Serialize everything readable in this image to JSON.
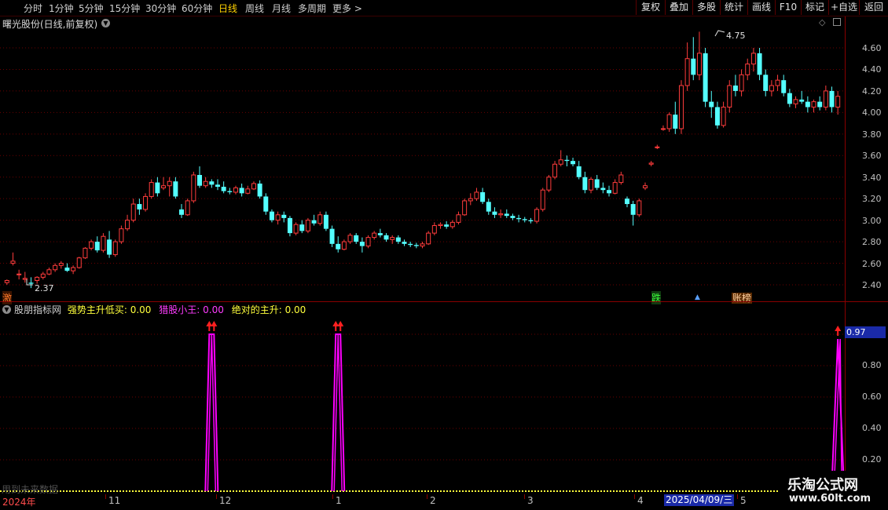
{
  "toolbar": {
    "periods": [
      "分时",
      "1分钟",
      "5分钟",
      "15分钟",
      "30分钟",
      "60分钟",
      "日线",
      "周线",
      "月线",
      "多周期",
      "更多"
    ],
    "active_period": "日线",
    "more_arrow": ">",
    "right_buttons": [
      "复权",
      "叠加",
      "多股",
      "统计",
      "画线",
      "F10",
      "标记",
      "+自选",
      "返回"
    ]
  },
  "stock_title": "曙光股份(日线,前复权)",
  "price_axis": [
    "4.60",
    "4.40",
    "4.20",
    "4.00",
    "3.80",
    "3.60",
    "3.40",
    "3.20",
    "3.00",
    "2.80",
    "2.60",
    "2.40"
  ],
  "price_annotations": {
    "high": "4.75",
    "low": "2.37"
  },
  "chart_tags": {
    "left": "激",
    "die": "跌",
    "zhang": "账榜"
  },
  "indicator": {
    "name": "股朋指标网",
    "line1_label": "强势主升低买:",
    "line1_value": "0.00",
    "line2_label": "猎股小王:",
    "line2_value": "0.00",
    "line3_label": "绝对的主升:",
    "line3_value": "0.00",
    "current_value": "0.97",
    "axis": [
      "0.80",
      "0.60",
      "0.40",
      "0.20"
    ]
  },
  "footer_note": "用到未来数据",
  "date_axis": {
    "labels": [
      "2024年",
      "11",
      "12",
      "1",
      "2",
      "3",
      "4",
      "5"
    ],
    "cursor_date": "2025/04/09/三"
  },
  "watermark": {
    "line1": "乐淘公式网",
    "line2": "www.60lt.com"
  },
  "colors": {
    "up": "#ff3c3c",
    "down": "#54ffff",
    "indicator": "#ff00ff",
    "active": "#ffd200"
  },
  "chart_data": {
    "type": "candlestick",
    "y_axis": {
      "min": 2.3,
      "max": 4.8,
      "ticks": [
        2.4,
        2.6,
        2.8,
        3.0,
        3.2,
        3.4,
        3.6,
        3.8,
        4.0,
        4.2,
        4.4,
        4.6
      ]
    },
    "candles": [
      [
        2.42,
        2.45,
        2.4,
        2.44
      ],
      [
        2.6,
        2.7,
        2.58,
        2.62
      ],
      [
        2.5,
        2.54,
        2.45,
        2.5
      ],
      [
        2.45,
        2.52,
        2.42,
        2.46
      ],
      [
        2.42,
        2.47,
        2.37,
        2.41
      ],
      [
        2.44,
        2.48,
        2.41,
        2.47
      ],
      [
        2.47,
        2.52,
        2.45,
        2.5
      ],
      [
        2.5,
        2.56,
        2.49,
        2.54
      ],
      [
        2.54,
        2.6,
        2.52,
        2.58
      ],
      [
        2.58,
        2.62,
        2.55,
        2.6
      ],
      [
        2.56,
        2.6,
        2.52,
        2.53
      ],
      [
        2.53,
        2.58,
        2.5,
        2.56
      ],
      [
        2.56,
        2.66,
        2.55,
        2.65
      ],
      [
        2.65,
        2.75,
        2.64,
        2.74
      ],
      [
        2.74,
        2.82,
        2.72,
        2.8
      ],
      [
        2.8,
        2.85,
        2.7,
        2.72
      ],
      [
        2.72,
        2.88,
        2.7,
        2.85
      ],
      [
        2.82,
        2.9,
        2.65,
        2.68
      ],
      [
        2.68,
        2.82,
        2.66,
        2.8
      ],
      [
        2.8,
        2.95,
        2.78,
        2.92
      ],
      [
        2.92,
        3.05,
        2.9,
        3.0
      ],
      [
        3.0,
        3.2,
        2.98,
        3.15
      ],
      [
        3.15,
        3.2,
        3.05,
        3.1
      ],
      [
        3.1,
        3.25,
        3.08,
        3.22
      ],
      [
        3.22,
        3.38,
        3.2,
        3.35
      ],
      [
        3.35,
        3.4,
        3.22,
        3.25
      ],
      [
        3.3,
        3.4,
        3.28,
        3.32
      ],
      [
        3.32,
        3.4,
        3.22,
        3.36
      ],
      [
        3.36,
        3.4,
        3.2,
        3.22
      ],
      [
        3.1,
        3.15,
        3.02,
        3.05
      ],
      [
        3.05,
        3.2,
        3.04,
        3.18
      ],
      [
        3.18,
        3.45,
        3.16,
        3.42
      ],
      [
        3.42,
        3.5,
        3.3,
        3.32
      ],
      [
        3.32,
        3.4,
        3.3,
        3.36
      ],
      [
        3.36,
        3.38,
        3.3,
        3.33
      ],
      [
        3.33,
        3.38,
        3.28,
        3.31
      ],
      [
        3.31,
        3.36,
        3.25,
        3.27
      ],
      [
        3.27,
        3.3,
        3.24,
        3.26
      ],
      [
        3.26,
        3.32,
        3.24,
        3.3
      ],
      [
        3.3,
        3.34,
        3.22,
        3.25
      ],
      [
        3.25,
        3.32,
        3.24,
        3.29
      ],
      [
        3.29,
        3.36,
        3.28,
        3.34
      ],
      [
        3.34,
        3.37,
        3.2,
        3.22
      ],
      [
        3.22,
        3.25,
        3.05,
        3.08
      ],
      [
        3.08,
        3.1,
        2.98,
        3.0
      ],
      [
        3.0,
        3.08,
        2.96,
        3.05
      ],
      [
        3.05,
        3.08,
        2.98,
        3.02
      ],
      [
        3.02,
        3.04,
        2.85,
        2.88
      ],
      [
        2.88,
        2.98,
        2.86,
        2.96
      ],
      [
        2.96,
        3.0,
        2.88,
        2.9
      ],
      [
        2.9,
        3.02,
        2.88,
        3.0
      ],
      [
        3.0,
        3.05,
        2.95,
        2.97
      ],
      [
        2.97,
        3.08,
        2.95,
        3.05
      ],
      [
        3.05,
        3.08,
        2.9,
        2.92
      ],
      [
        2.92,
        2.95,
        2.75,
        2.78
      ],
      [
        2.78,
        2.85,
        2.7,
        2.73
      ],
      [
        2.73,
        2.82,
        2.72,
        2.8
      ],
      [
        2.8,
        2.88,
        2.78,
        2.86
      ],
      [
        2.86,
        2.88,
        2.78,
        2.8
      ],
      [
        2.8,
        2.84,
        2.7,
        2.76
      ],
      [
        2.76,
        2.86,
        2.74,
        2.84
      ],
      [
        2.84,
        2.9,
        2.82,
        2.88
      ],
      [
        2.88,
        2.92,
        2.84,
        2.86
      ],
      [
        2.86,
        2.88,
        2.8,
        2.82
      ],
      [
        2.82,
        2.86,
        2.78,
        2.84
      ],
      [
        2.84,
        2.86,
        2.78,
        2.8
      ],
      [
        2.8,
        2.82,
        2.76,
        2.78
      ],
      [
        2.78,
        2.8,
        2.75,
        2.77
      ],
      [
        2.77,
        2.79,
        2.74,
        2.76
      ],
      [
        2.76,
        2.8,
        2.74,
        2.78
      ],
      [
        2.78,
        2.9,
        2.77,
        2.88
      ],
      [
        2.88,
        2.98,
        2.86,
        2.95
      ],
      [
        2.95,
        2.98,
        2.92,
        2.96
      ],
      [
        2.96,
        2.99,
        2.92,
        2.94
      ],
      [
        2.94,
        3.0,
        2.92,
        2.98
      ],
      [
        2.98,
        3.08,
        2.96,
        3.05
      ],
      [
        3.05,
        3.2,
        3.04,
        3.18
      ],
      [
        3.18,
        3.25,
        3.14,
        3.2
      ],
      [
        3.2,
        3.3,
        3.18,
        3.26
      ],
      [
        3.26,
        3.3,
        3.15,
        3.17
      ],
      [
        3.17,
        3.2,
        3.05,
        3.08
      ],
      [
        3.08,
        3.12,
        3.02,
        3.05
      ],
      [
        3.05,
        3.1,
        3.02,
        3.06
      ],
      [
        3.06,
        3.1,
        3.02,
        3.04
      ],
      [
        3.04,
        3.06,
        3.0,
        3.02
      ],
      [
        3.02,
        3.05,
        2.98,
        3.01
      ],
      [
        3.01,
        3.03,
        2.98,
        3.0
      ],
      [
        3.0,
        3.02,
        2.97,
        2.99
      ],
      [
        2.99,
        3.12,
        2.97,
        3.1
      ],
      [
        3.1,
        3.3,
        3.08,
        3.28
      ],
      [
        3.28,
        3.42,
        3.26,
        3.4
      ],
      [
        3.4,
        3.55,
        3.38,
        3.52
      ],
      [
        3.52,
        3.65,
        3.5,
        3.56
      ],
      [
        3.56,
        3.6,
        3.5,
        3.55
      ],
      [
        3.55,
        3.58,
        3.5,
        3.52
      ],
      [
        3.5,
        3.55,
        3.38,
        3.4
      ],
      [
        3.4,
        3.45,
        3.25,
        3.28
      ],
      [
        3.28,
        3.4,
        3.25,
        3.38
      ],
      [
        3.38,
        3.42,
        3.28,
        3.3
      ],
      [
        3.3,
        3.35,
        3.25,
        3.28
      ],
      [
        3.28,
        3.32,
        3.22,
        3.25
      ],
      [
        3.25,
        3.38,
        3.24,
        3.35
      ],
      [
        3.35,
        3.45,
        3.33,
        3.42
      ],
      [
        3.2,
        3.22,
        3.12,
        3.15
      ],
      [
        3.15,
        3.18,
        2.95,
        3.05
      ],
      [
        3.05,
        3.2,
        3.03,
        3.18
      ],
      [
        3.3,
        3.35,
        3.28,
        3.32
      ],
      [
        3.52,
        3.55,
        3.5,
        3.53
      ],
      [
        3.68,
        3.7,
        3.66,
        3.68
      ],
      [
        3.85,
        3.88,
        3.83,
        3.85
      ],
      [
        3.85,
        4.0,
        3.82,
        3.98
      ],
      [
        3.98,
        4.1,
        3.8,
        3.85
      ],
      [
        3.85,
        4.3,
        3.8,
        4.25
      ],
      [
        4.25,
        4.65,
        4.2,
        4.5
      ],
      [
        4.5,
        4.7,
        4.3,
        4.35
      ],
      [
        4.35,
        4.75,
        4.3,
        4.55
      ],
      [
        4.55,
        4.6,
        4.05,
        4.1
      ],
      [
        4.1,
        4.2,
        3.95,
        4.05
      ],
      [
        4.05,
        4.1,
        3.85,
        3.88
      ],
      [
        3.88,
        4.1,
        3.86,
        4.05
      ],
      [
        4.05,
        4.3,
        4.0,
        4.25
      ],
      [
        4.25,
        4.35,
        4.15,
        4.2
      ],
      [
        4.2,
        4.4,
        4.15,
        4.35
      ],
      [
        4.35,
        4.5,
        4.3,
        4.45
      ],
      [
        4.45,
        4.6,
        4.38,
        4.55
      ],
      [
        4.55,
        4.6,
        4.3,
        4.35
      ],
      [
        4.35,
        4.4,
        4.15,
        4.2
      ],
      [
        4.2,
        4.3,
        4.15,
        4.25
      ],
      [
        4.25,
        4.35,
        4.2,
        4.3
      ],
      [
        4.3,
        4.35,
        4.15,
        4.18
      ],
      [
        4.18,
        4.22,
        4.05,
        4.08
      ],
      [
        4.08,
        4.15,
        4.04,
        4.12
      ],
      [
        4.12,
        4.2,
        4.08,
        4.1
      ],
      [
        4.1,
        4.15,
        4.0,
        4.05
      ],
      [
        4.05,
        4.12,
        4.0,
        4.1
      ],
      [
        4.1,
        4.15,
        4.02,
        4.05
      ],
      [
        4.05,
        4.25,
        4.02,
        4.2
      ],
      [
        4.2,
        4.24,
        4.0,
        4.05
      ],
      [
        4.05,
        4.2,
        3.98,
        4.15
      ]
    ],
    "indicator_spikes": [
      {
        "index": 34,
        "value": 1.0,
        "arrows": 2
      },
      {
        "index": 55,
        "value": 1.0,
        "arrows": 2
      },
      {
        "index": 138,
        "value": 0.97,
        "arrows": 1
      }
    ]
  }
}
